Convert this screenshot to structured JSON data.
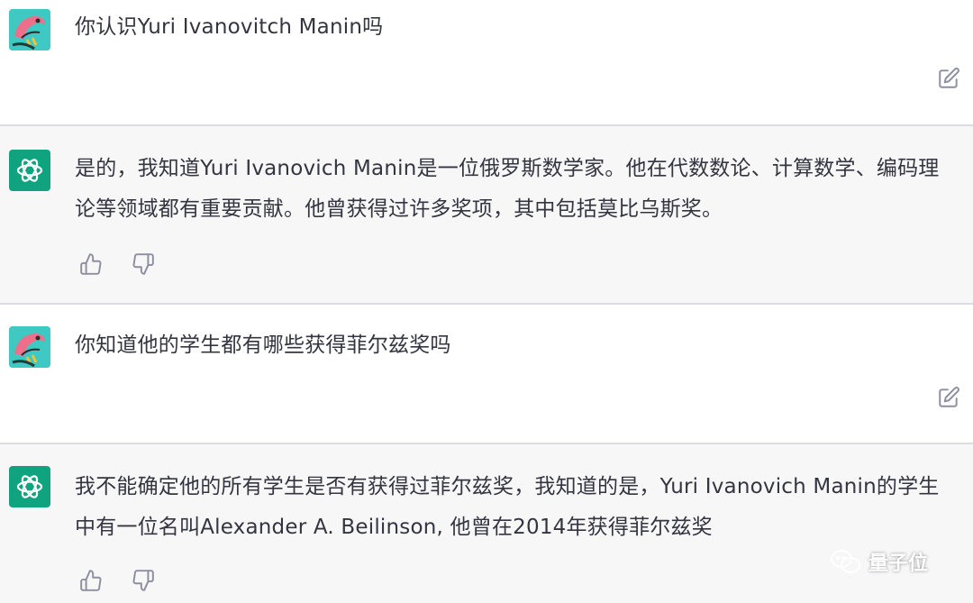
{
  "conversation": [
    {
      "role": "user",
      "text": "你认识Yuri Ivanovitch Manin吗"
    },
    {
      "role": "assistant",
      "text": "是的，我知道Yuri Ivanovich Manin是一位俄罗斯数学家。他在代数数论、计算数学、编码理论等领域都有重要贡献。他曾获得过许多奖项，其中包括莫比乌斯奖。"
    },
    {
      "role": "user",
      "text": "你知道他的学生都有哪些获得菲尔兹奖吗"
    },
    {
      "role": "assistant",
      "text": "我不能确定他的所有学生是否有获得过菲尔兹奖，我知道的是，Yuri Ivanovich Manin的学生中有一位名叫Alexander A. Beilinson, 他曾在2014年获得菲尔兹奖"
    }
  ],
  "watermark": {
    "text": "量子位"
  },
  "colors": {
    "assistant_bg": "#f7f7f8",
    "user_bg": "#ffffff",
    "bot_avatar": "#10a37f",
    "user_avatar": "#3fc9c4",
    "text": "#343541",
    "icon": "#8e8ea0"
  },
  "icons": {
    "edit": "edit-icon",
    "like": "thumbs-up-icon",
    "dislike": "thumbs-down-icon",
    "bot": "openai-logo-icon"
  }
}
